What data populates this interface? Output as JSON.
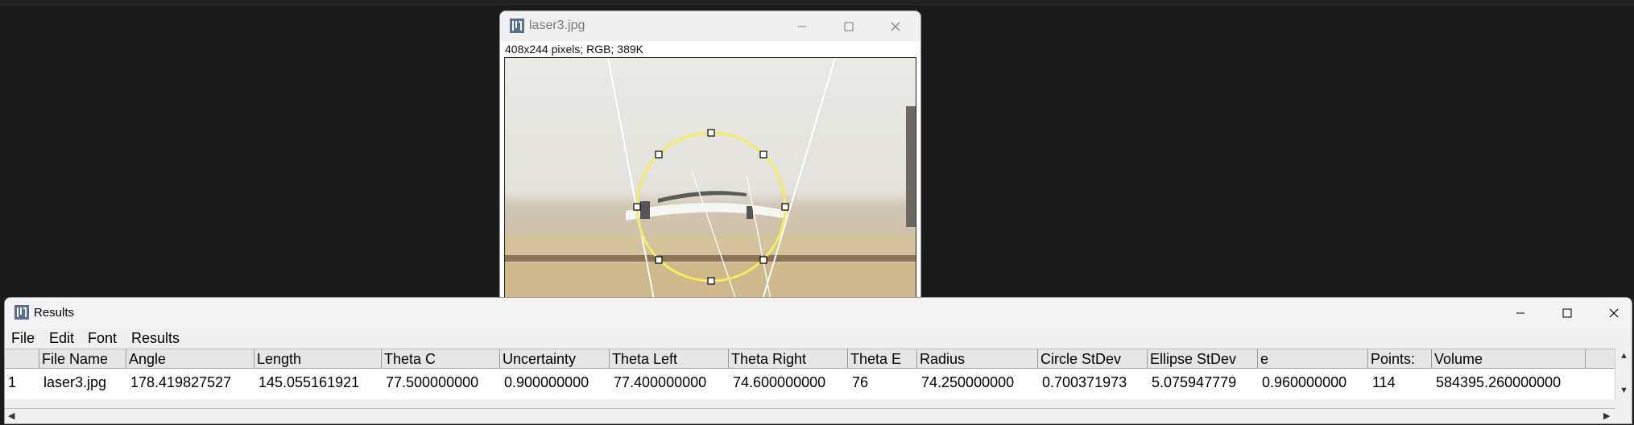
{
  "image_window": {
    "title": "laser3.jpg",
    "info": "408x244 pixels; RGB; 389K"
  },
  "results_window": {
    "title": "Results",
    "menu": [
      "File",
      "Edit",
      "Font",
      "Results"
    ],
    "columns": [
      "",
      "File Name",
      "Angle",
      "Length",
      "Theta C",
      "Uncertainty",
      "Theta Left",
      "Theta Right",
      "Theta E",
      "Radius",
      "Circle StDev",
      "Ellipse StDev",
      "e",
      "Points:",
      "Volume"
    ],
    "rows": [
      [
        "1",
        "laser3.jpg",
        "178.419827527",
        "145.055161921",
        "77.500000000",
        "0.900000000",
        "77.400000000",
        "74.600000000",
        "76",
        "74.250000000",
        "0.700371973",
        "5.075947779",
        "0.960000000",
        "114",
        "584395.260000000"
      ]
    ]
  },
  "icons": {
    "app": "imagej-icon",
    "minimize": "minimize-icon",
    "maximize": "maximize-icon",
    "close": "close-icon"
  }
}
